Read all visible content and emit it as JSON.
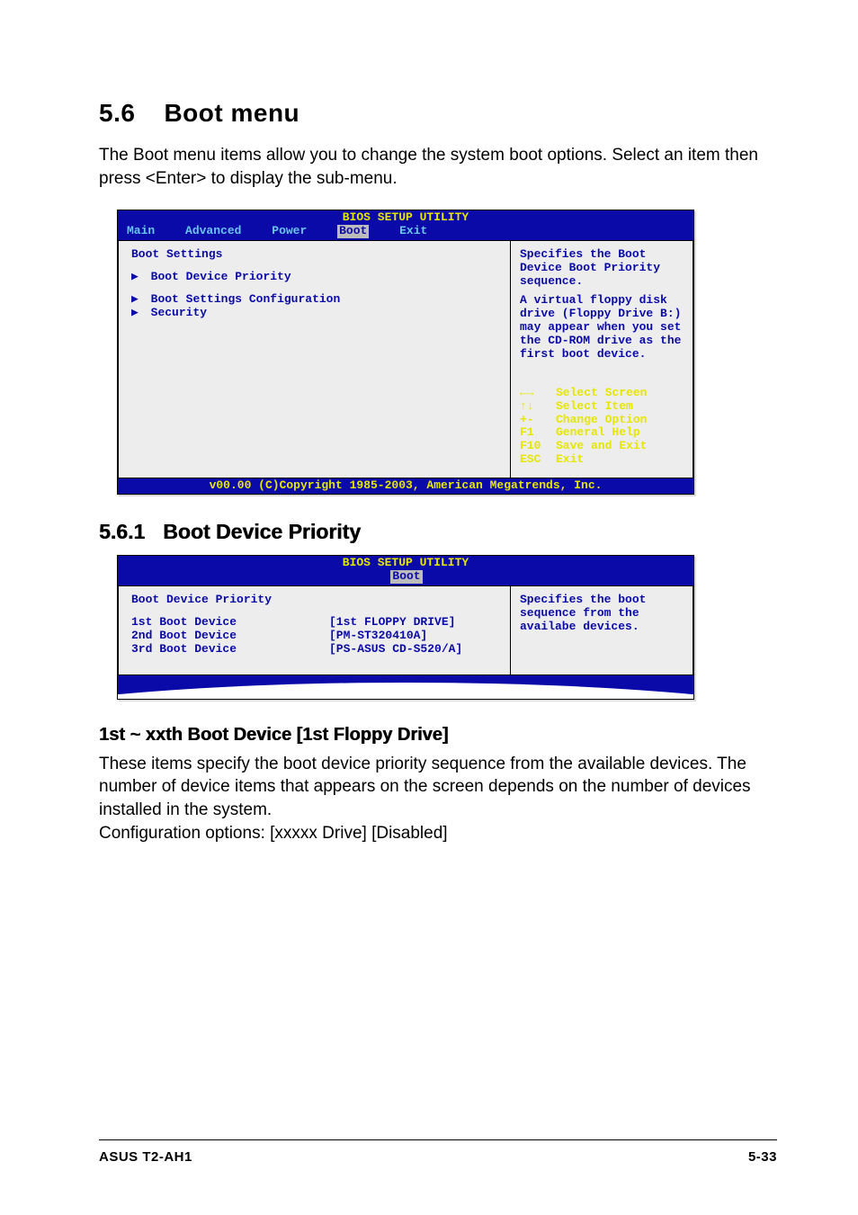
{
  "section": {
    "num": "5.6",
    "title": "Boot menu"
  },
  "intro": "The Boot menu items allow you to change the system boot options. Select an item then press <Enter> to display the sub-menu.",
  "bios1": {
    "title": "BIOS SETUP UTILITY",
    "tabs": {
      "t0": "Main",
      "t1": "Advanced",
      "t2": "Power",
      "t3": "Boot",
      "t4": "Exit"
    },
    "left": {
      "heading": "Boot Settings",
      "i0": "Boot Device Priority",
      "i1": "Boot Settings Configuration",
      "i2": "Security"
    },
    "help1": "Specifies the Boot Device Boot Priority sequence.",
    "help2": "A virtual floppy disk drive (Floppy Drive B:) may appear when you set the CD-ROM drive as the first boot device.",
    "keys": {
      "k0": "←→",
      "v0": "Select Screen",
      "k1": "↑↓",
      "v1": "Select Item",
      "k2": "+-",
      "v2": "Change Option",
      "k3": "F1",
      "v3": "General Help",
      "k4": "F10",
      "v4": "Save and Exit",
      "k5": "ESC",
      "v5": "Exit"
    },
    "footer": "v00.00 (C)Copyright 1985-2003, American Megatrends, Inc."
  },
  "subsec": {
    "num": "5.6.1",
    "title": "Boot Device Priority"
  },
  "bios2": {
    "title": "BIOS SETUP UTILITY",
    "tab": "Boot",
    "heading": "Boot Device Priority",
    "r0l": "1st Boot Device",
    "r0v": "[1st FLOPPY DRIVE]",
    "r1l": "2nd Boot Device",
    "r1v": "[PM-ST320410A]",
    "r2l": "3rd Boot Device",
    "r2v": "[PS-ASUS CD-S520/A]",
    "help": "Specifies the boot sequence from the availabe devices."
  },
  "item": {
    "title": "1st ~ xxth Boot Device [1st Floppy Drive]"
  },
  "desc1": "These items specify the boot device priority sequence from the available devices. The number of device items that appears on the screen depends on the number of devices installed in the system.",
  "desc2": "Configuration options: [xxxxx Drive] [Disabled]",
  "footer": {
    "left": "ASUS T2-AH1",
    "right": "5-33"
  }
}
